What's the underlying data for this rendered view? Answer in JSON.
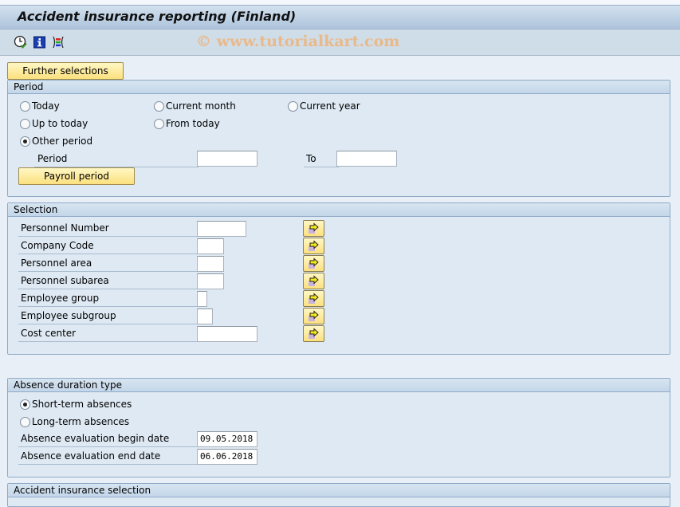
{
  "header": {
    "title": "Accident insurance reporting (Finland)",
    "watermark": "© www.tutorialkart.com"
  },
  "toolbar": {
    "icons": [
      "execute-clock-icon",
      "info-icon",
      "selection-variant-icon"
    ]
  },
  "further_selections_label": "Further selections",
  "period": {
    "title": "Period",
    "options": [
      {
        "label": "Today",
        "selected": false
      },
      {
        "label": "Current month",
        "selected": false
      },
      {
        "label": "Current year",
        "selected": false
      },
      {
        "label": "Up to today",
        "selected": false
      },
      {
        "label": "From today",
        "selected": false
      },
      {
        "label": "Other period",
        "selected": true
      }
    ],
    "period_label": "Period",
    "period_from": "",
    "to_label": "To",
    "period_to": "",
    "payroll_period_label": "Payroll period"
  },
  "selection": {
    "title": "Selection",
    "fields": [
      {
        "label": "Personnel Number",
        "value": ""
      },
      {
        "label": "Company Code",
        "value": ""
      },
      {
        "label": "Personnel area",
        "value": ""
      },
      {
        "label": "Personnel subarea",
        "value": ""
      },
      {
        "label": "Employee group",
        "value": ""
      },
      {
        "label": "Employee subgroup",
        "value": ""
      },
      {
        "label": "Cost center",
        "value": ""
      }
    ]
  },
  "absence": {
    "title": "Absence duration type",
    "options": [
      {
        "label": "Short-term absences",
        "selected": true
      },
      {
        "label": "Long-term absences",
        "selected": false
      }
    ],
    "begin_label": "Absence evaluation begin date",
    "begin_value": "09.05.2018",
    "end_label": "Absence evaluation end date",
    "end_value": "06.06.2018"
  },
  "accident": {
    "title": "Accident insurance selection"
  },
  "colors": {
    "background": "#e8eff7",
    "group_body": "#dee9f3",
    "button_yellow": "#fbe07e",
    "watermark": "#e9b98a"
  }
}
